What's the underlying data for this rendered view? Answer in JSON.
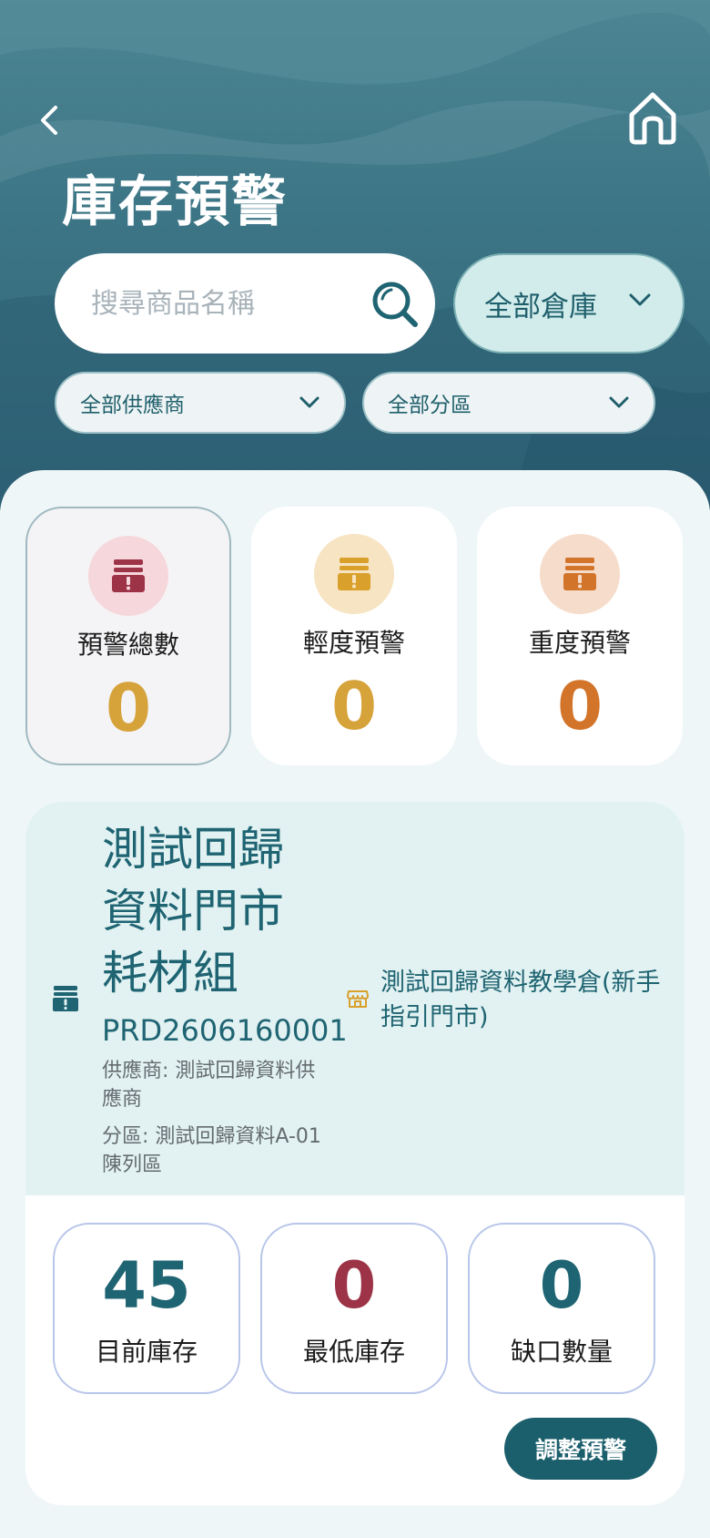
{
  "header": {
    "title": "庫存預警",
    "search_placeholder": "搜尋商品名稱",
    "search_value": "",
    "warehouse_filter": "全部倉庫",
    "supplier_filter": "全部供應商",
    "zone_filter": "全部分區"
  },
  "stats": [
    {
      "label": "預警總數",
      "value": "0",
      "color": "#d6a23a",
      "icon_bg": "#f6d7dc",
      "icon_color": "#9c3347",
      "icon": "warning-box-icon",
      "selected": true
    },
    {
      "label": "輕度預警",
      "value": "0",
      "color": "#d6a23a",
      "icon_bg": "#f6e4c2",
      "icon_color": "#d9a02c",
      "icon": "warning-box-icon",
      "selected": false
    },
    {
      "label": "重度預警",
      "value": "0",
      "color": "#d2742a",
      "icon_bg": "#f6dccb",
      "icon_color": "#d2742a",
      "icon": "warning-box-icon",
      "selected": false
    }
  ],
  "product": {
    "name": "測試回歸資料門市耗材組",
    "code": "PRD2606160001",
    "supplier": "供應商: 測試回歸資料供應商",
    "zone": "分區: 測試回歸資料A-01陳列區",
    "store": "測試回歸資料教學倉(新手指引門市)",
    "quantities": [
      {
        "value": "45",
        "label": "目前庫存",
        "color": "#1f6472"
      },
      {
        "value": "0",
        "label": "最低庫存",
        "color": "#9c3347"
      },
      {
        "value": "0",
        "label": "缺口數量",
        "color": "#1f6472"
      }
    ],
    "adjust_label": "調整預警"
  },
  "colors": {
    "primary": "#1b5f6c",
    "header_bg": "#3d7686",
    "panel_bg": "#eff6f7"
  }
}
